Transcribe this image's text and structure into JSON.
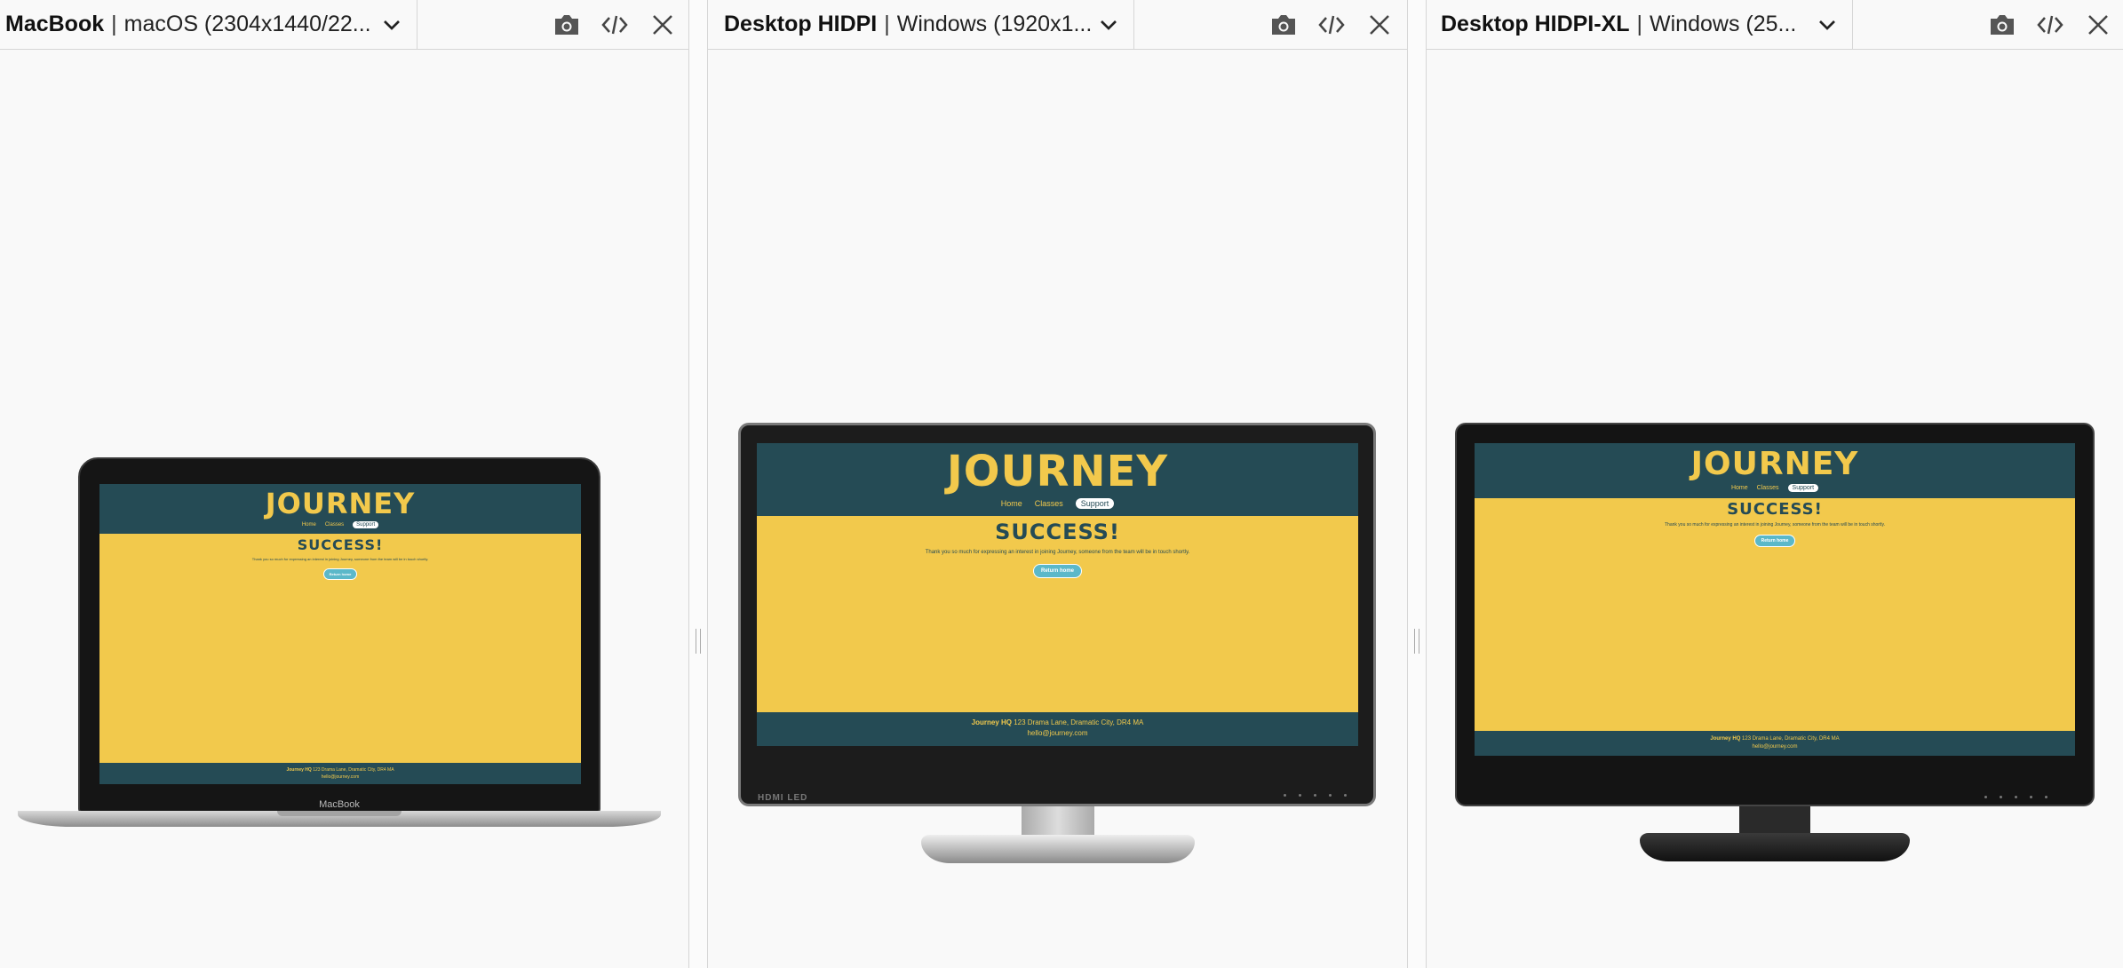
{
  "site": {
    "logo": "JOURNEY",
    "nav": [
      "Home",
      "Classes",
      "Support"
    ],
    "active_nav": "Support",
    "heading": "SUCCESS!",
    "message": "Thank you so much for expressing an interest in joining Journey, someone from the team will be in touch shortly.",
    "button": "Return home",
    "footer_label": "Journey HQ",
    "footer_address": " 123 Drama Lane, Dramatic City, DR4 MA",
    "footer_email": "hello@journey.com"
  },
  "panels": [
    {
      "device": "MacBook",
      "detail": "macOS (2304x1440/22...",
      "bezel_label": "MacBook"
    },
    {
      "device": "Desktop HIDPI",
      "detail": "Windows (1920x1...",
      "bezel_label": "HDMI LED"
    },
    {
      "device": "Desktop HIDPI-XL",
      "detail": "Windows (25...",
      "bezel_label": ""
    }
  ],
  "icons": {
    "screenshot": "camera-icon",
    "code": "code-icon",
    "close": "close-icon",
    "dropdown": "chevron-down-icon"
  },
  "colors": {
    "site_teal": "#254b55",
    "site_yellow": "#f2c94c",
    "button": "#5bb8c9"
  }
}
